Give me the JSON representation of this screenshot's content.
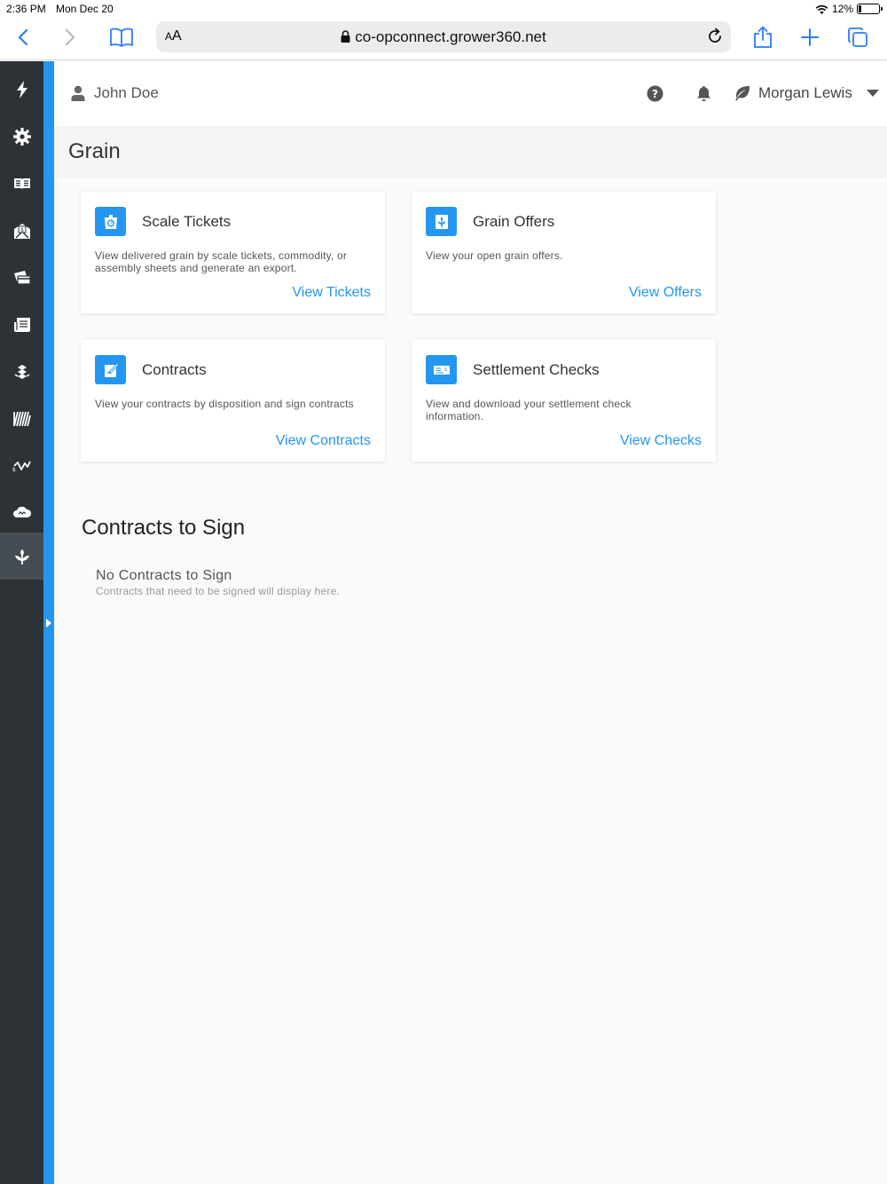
{
  "status_bar": {
    "time": "2:36 PM",
    "date": "Mon Dec 20",
    "battery": "12%",
    "battery_level": 0.12
  },
  "browser": {
    "text_size_label_small": "A",
    "text_size_label_large": "A",
    "url": "co-opconnect.grower360.net",
    "icons": [
      "back-icon",
      "forward-icon",
      "bookmarks-icon",
      "lock-icon",
      "reload-icon",
      "share-icon",
      "new-tab-icon",
      "tabs-icon"
    ]
  },
  "sidebar": {
    "items": [
      {
        "icon": "lightning-icon"
      },
      {
        "icon": "gear-icon"
      },
      {
        "icon": "news-icon"
      },
      {
        "icon": "statements-icon"
      },
      {
        "icon": "payments-icon"
      },
      {
        "icon": "documents-icon"
      },
      {
        "icon": "agronomy-icon"
      },
      {
        "icon": "fields-icon"
      },
      {
        "icon": "markets-icon"
      },
      {
        "icon": "weather-icon"
      },
      {
        "icon": "grain-icon",
        "active": true
      }
    ]
  },
  "header": {
    "user_name": "John Doe",
    "account_name": "Morgan Lewis"
  },
  "page": {
    "title": "Grain"
  },
  "cards": [
    {
      "title": "Scale Tickets",
      "description": "View delivered grain by scale tickets, commodity, or assembly sheets and generate an export.",
      "link": "View Tickets",
      "icon": "scale-icon"
    },
    {
      "title": "Grain Offers",
      "description": "View your open grain offers.",
      "link": "View Offers",
      "icon": "grain-offer-icon"
    },
    {
      "title": "Contracts",
      "description": "View your contracts by disposition and sign contracts",
      "link": "View Contracts",
      "icon": "contract-sign-icon"
    },
    {
      "title": "Settlement Checks",
      "description": "View and download your settlement check information.",
      "link": "View Checks",
      "icon": "check-icon"
    }
  ],
  "contracts_to_sign": {
    "title": "Contracts to Sign",
    "empty_title": "No Contracts to Sign",
    "empty_subtitle": "Contracts that need to be signed will display here."
  },
  "colors": {
    "accent": "#2496ef",
    "sidebar": "#2d3236",
    "sidebar_active": "#464d52",
    "safari_blue": "#2b7cf6"
  }
}
